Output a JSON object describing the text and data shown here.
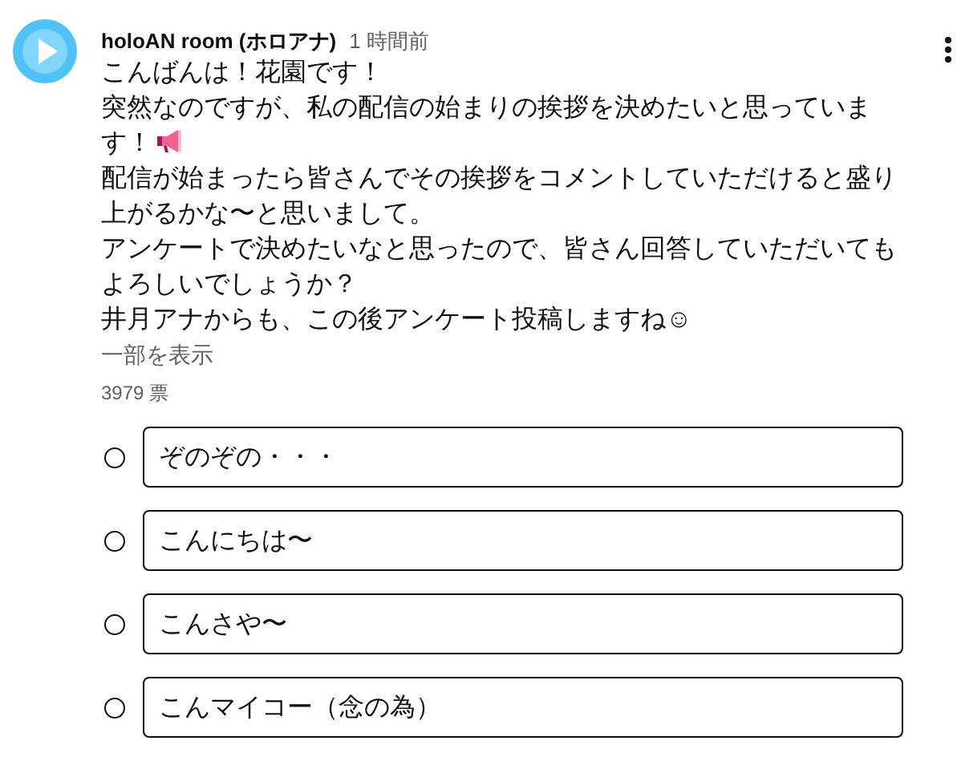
{
  "post": {
    "author": "holoAN room (ホロアナ)",
    "time": "1 時間前",
    "paragraphs": [
      {
        "kind": "plain",
        "text": "こんばんは！花園です！"
      },
      {
        "kind": "megaphone",
        "text": "突然なのですが、私の配信の始まりの挨拶を決めたいと思っています！"
      },
      {
        "kind": "plain",
        "text": "配信が始まったら皆さんでその挨拶をコメントしていただけると盛り上がるかな〜と思いまして。"
      },
      {
        "kind": "plain",
        "text": "アンケートで決めたいなと思ったので、皆さん回答していただいてもよろしいでしょうか？"
      },
      {
        "kind": "plain",
        "text": "井月アナからも、この後アンケート投稿しますね☺"
      }
    ],
    "show_more": "一部を表示",
    "votes": "3979 票",
    "options": [
      {
        "label": "ぞのぞの・・・",
        "selected": false
      },
      {
        "label": "こんにちは〜",
        "selected": false
      },
      {
        "label": "こんさや〜",
        "selected": false
      },
      {
        "label": "こんマイコー（念の為）",
        "selected": false
      }
    ]
  }
}
